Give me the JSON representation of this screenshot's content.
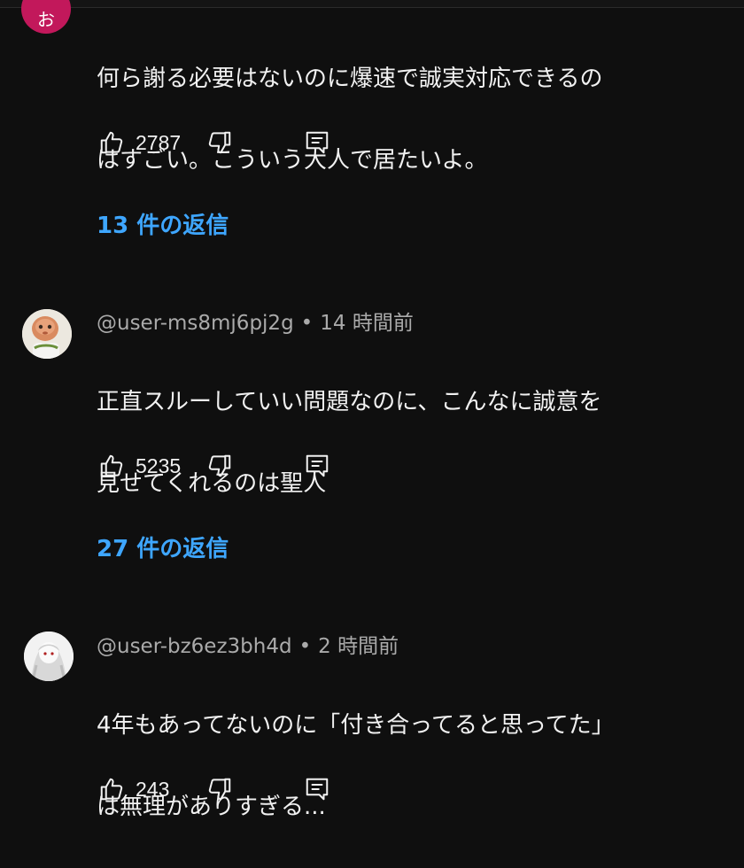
{
  "comments": [
    {
      "author": "",
      "time": "",
      "text_line1": "何ら謝る必要はないのに爆速で誠実対応できるの",
      "text_line2": "はすごい。こういう大人で居たいよ。",
      "likes": "2787",
      "replies": "13 件の返信",
      "avatar": {
        "icon": "avatar-letter-icon",
        "letter": "お",
        "bg": "#c2185b"
      }
    },
    {
      "author": "@user-ms8mj6pj2g",
      "time": "14 時間前",
      "text_line1": "正直スルーしていい問題なのに、こんなに誠意を",
      "text_line2": "見せてくれるのは聖人",
      "likes": "5235",
      "replies": "27 件の返信",
      "avatar": {
        "icon": "doll-avatar-icon"
      }
    },
    {
      "author": "@user-bz6ez3bh4d",
      "time": "2 時間前",
      "text_line1": "4年もあってないのに「付き合ってると思ってた」",
      "text_line2": "は無理がありすぎる...",
      "likes": "243",
      "avatar": {
        "icon": "anime-avatar-icon"
      }
    }
  ],
  "separator": "•",
  "colors": {
    "background": "#0f0f0f",
    "text": "#f1f1f1",
    "meta": "#aaaaaa",
    "link": "#3ea6ff"
  }
}
